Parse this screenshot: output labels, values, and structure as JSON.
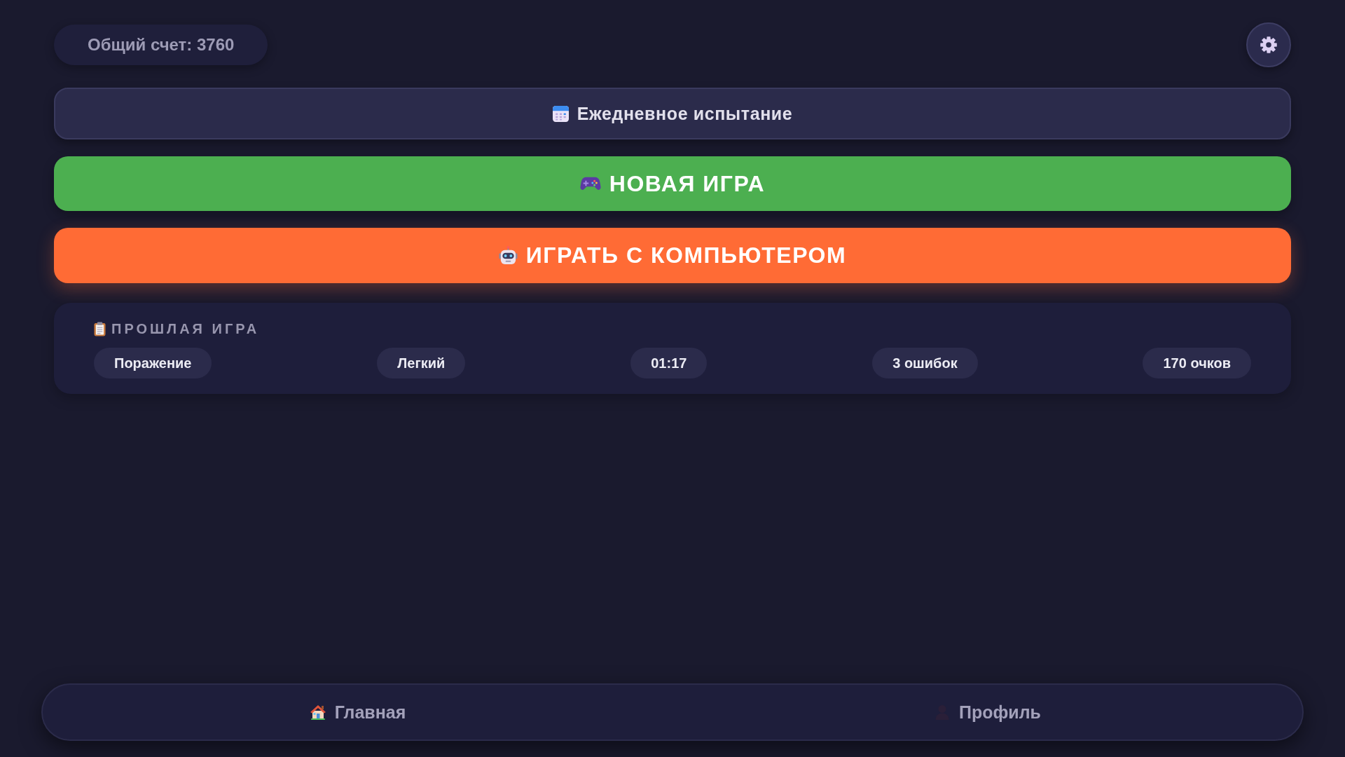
{
  "header": {
    "total_score": "Общий счет: 3760"
  },
  "actions": [
    {
      "kind": "daily",
      "label": "Ежедневное испытание"
    },
    {
      "kind": "new_game",
      "label": "НОВАЯ ИГРА"
    },
    {
      "kind": "vs_computer",
      "label": "ИГРАТЬ С КОМПЬЮТЕРОМ"
    }
  ],
  "last_game": {
    "title": "ПРОШЛАЯ ИГРА",
    "stats": [
      "Поражение",
      "Легкий",
      "01:17",
      "3 ошибок",
      "170 очков"
    ]
  },
  "bottom_nav": [
    {
      "kind": "home",
      "label": "Главная",
      "selected": false
    },
    {
      "kind": "profile",
      "label": "Профиль",
      "selected": false
    }
  ]
}
